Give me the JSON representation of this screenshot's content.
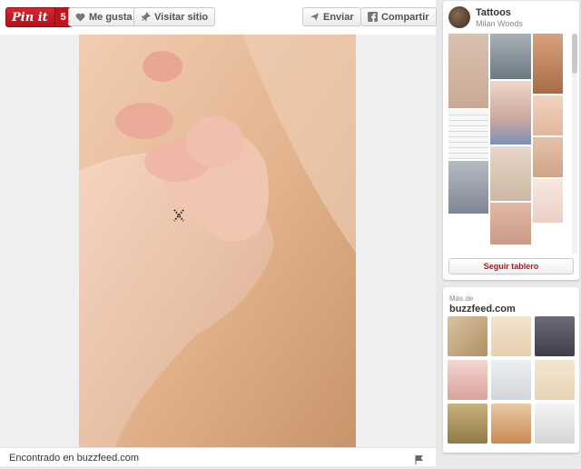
{
  "toolbar": {
    "pinit_label": "Pin it",
    "pin_count": "5",
    "like_label": "Me gusta",
    "visit_label": "Visitar sitio",
    "send_label": "Enviar",
    "share_label": "Compartir"
  },
  "footer": {
    "source_text": "Encontrado en buzzfeed.com"
  },
  "board": {
    "name": "Tattoos",
    "user": "Milan Woods",
    "follow_label": "Seguir tablero"
  },
  "more_from": {
    "label": "Más de",
    "site": "buzzfeed.com"
  },
  "colors": {
    "pinterest_red": "#cb2027",
    "background": "#e9e9e9"
  },
  "icons": [
    "heart-icon",
    "pin-icon",
    "send-icon",
    "facebook-icon",
    "flag-icon"
  ]
}
